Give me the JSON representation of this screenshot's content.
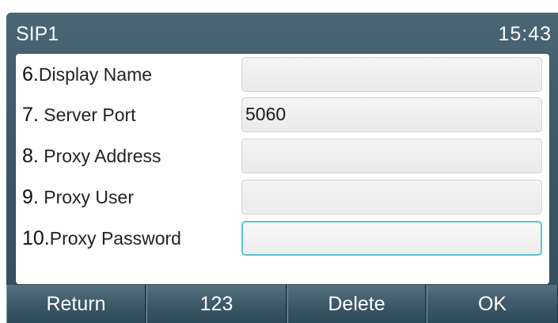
{
  "titlebar": {
    "title": "SIP1",
    "clock": "15:43"
  },
  "form": {
    "rows": [
      {
        "number": "6.",
        "label": "Display Name",
        "value": ""
      },
      {
        "number": "7.",
        "label": "Server Port",
        "value": "5060"
      },
      {
        "number": "8.",
        "label": "Proxy Address",
        "value": ""
      },
      {
        "number": "9.",
        "label": "Proxy User",
        "value": ""
      },
      {
        "number": "10.",
        "label": "Proxy Password",
        "value": ""
      }
    ]
  },
  "softkeys": {
    "return_label": "Return",
    "input_mode_label": "123",
    "delete_label": "Delete",
    "ok_label": "OK"
  },
  "colors": {
    "screen_background": "#3d5968",
    "focus_border": "#5cc3d4",
    "field_fill": "#eeeeee"
  }
}
